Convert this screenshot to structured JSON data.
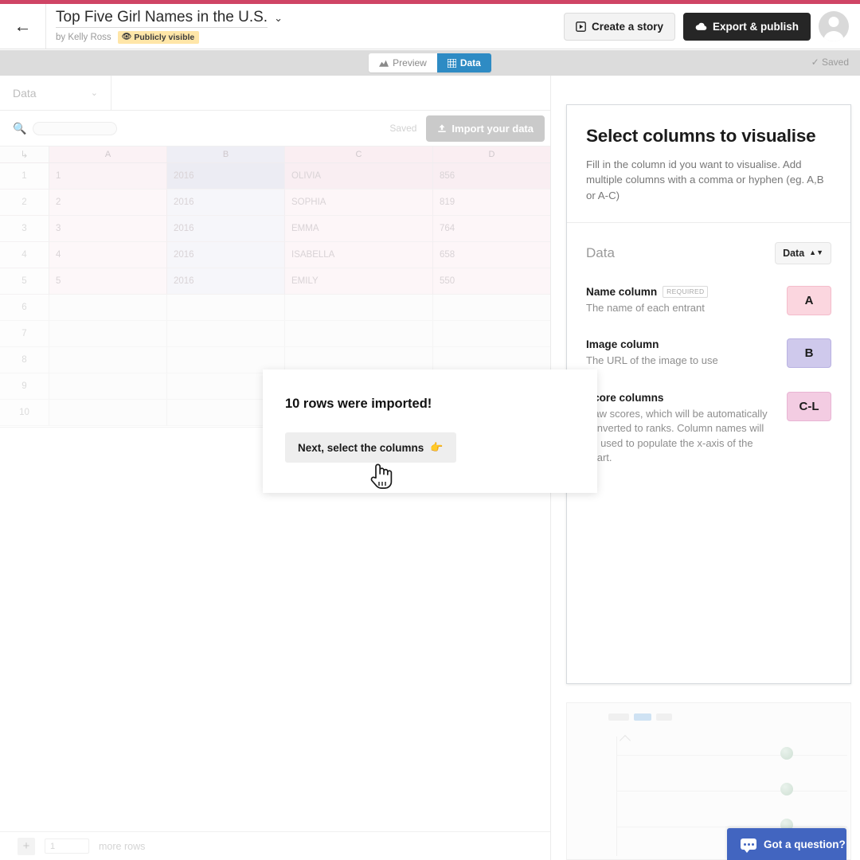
{
  "header": {
    "back_icon": "back-arrow-icon",
    "title": "Top Five Girl Names in the U.S.",
    "title_caret": "⌄",
    "byline": "by Kelly Ross",
    "visibility_badge": "Publicly visible",
    "visibility_icon": "eye-icon",
    "create_story_label": "Create a story",
    "create_story_icon": "play-box-icon",
    "export_label": "Export & publish",
    "export_icon": "cloud-upload-icon",
    "avatar_icon": "user-avatar-icon",
    "accent_color": "#cf4465"
  },
  "mode_bar": {
    "preview_label": "Preview",
    "preview_icon": "chart-icon",
    "data_label": "Data",
    "data_icon": "grid-icon",
    "active_tab": "Data",
    "saved_label": "Saved",
    "saved_icon": "check-icon"
  },
  "data_pane": {
    "sheet_tab_label": "Data",
    "sheet_tab_caret": "⌄",
    "search_icon": "search-icon",
    "search_value": "",
    "search_placeholder": "",
    "saved_label": "Saved",
    "import_label": "Import your data",
    "import_icon": "upload-icon",
    "corner_icon": "select-all-icon",
    "columns": [
      "A",
      "B",
      "C",
      "D"
    ],
    "rows": [
      {
        "n": "1",
        "A": "1",
        "B": "2016",
        "C": "OLIVIA",
        "D": "856"
      },
      {
        "n": "2",
        "A": "2",
        "B": "2016",
        "C": "SOPHIA",
        "D": "819"
      },
      {
        "n": "3",
        "A": "3",
        "B": "2016",
        "C": "EMMA",
        "D": "764"
      },
      {
        "n": "4",
        "A": "4",
        "B": "2016",
        "C": "ISABELLA",
        "D": "658"
      },
      {
        "n": "5",
        "A": "5",
        "B": "2016",
        "C": "EMILY",
        "D": "550"
      },
      {
        "n": "6",
        "A": "",
        "B": "",
        "C": "",
        "D": ""
      },
      {
        "n": "7",
        "A": "",
        "B": "",
        "C": "",
        "D": ""
      },
      {
        "n": "8",
        "A": "",
        "B": "",
        "C": "",
        "D": ""
      },
      {
        "n": "9",
        "A": "",
        "B": "",
        "C": "",
        "D": ""
      },
      {
        "n": "10",
        "A": "",
        "B": "",
        "C": "",
        "D": ""
      }
    ],
    "add_rows": {
      "plus_label": "+",
      "count_value": "1",
      "suffix_label": "more rows"
    }
  },
  "right_panel": {
    "title": "Select columns to visualise",
    "description": "Fill in the column id you want to visualise. Add multiple columns with a comma or hyphen (eg. A,B or A-C)",
    "source_label": "Data",
    "source_select_value": "Data",
    "fields": [
      {
        "label": "Name column",
        "required_badge": "REQUIRED",
        "help": "The name of each entrant",
        "value": "A",
        "chip_color": "#fbd6df"
      },
      {
        "label": "Image column",
        "required_badge": "",
        "help": "The URL of the image to use",
        "value": "B",
        "chip_color": "#cfc9ec"
      },
      {
        "label": "Score columns",
        "required_badge": "",
        "help": "Raw scores, which will be automatically converted to ranks. Column names will be used to populate the x-axis of the chart.",
        "value": "C-L",
        "chip_color": "#f3cce2"
      }
    ]
  },
  "modal": {
    "title": "10 rows were imported!",
    "button_label": "Next, select the columns",
    "button_emoji": "👉"
  },
  "chat": {
    "label": "Got a question?",
    "icon": "chat-bubble-icon",
    "color": "#4265c0"
  }
}
